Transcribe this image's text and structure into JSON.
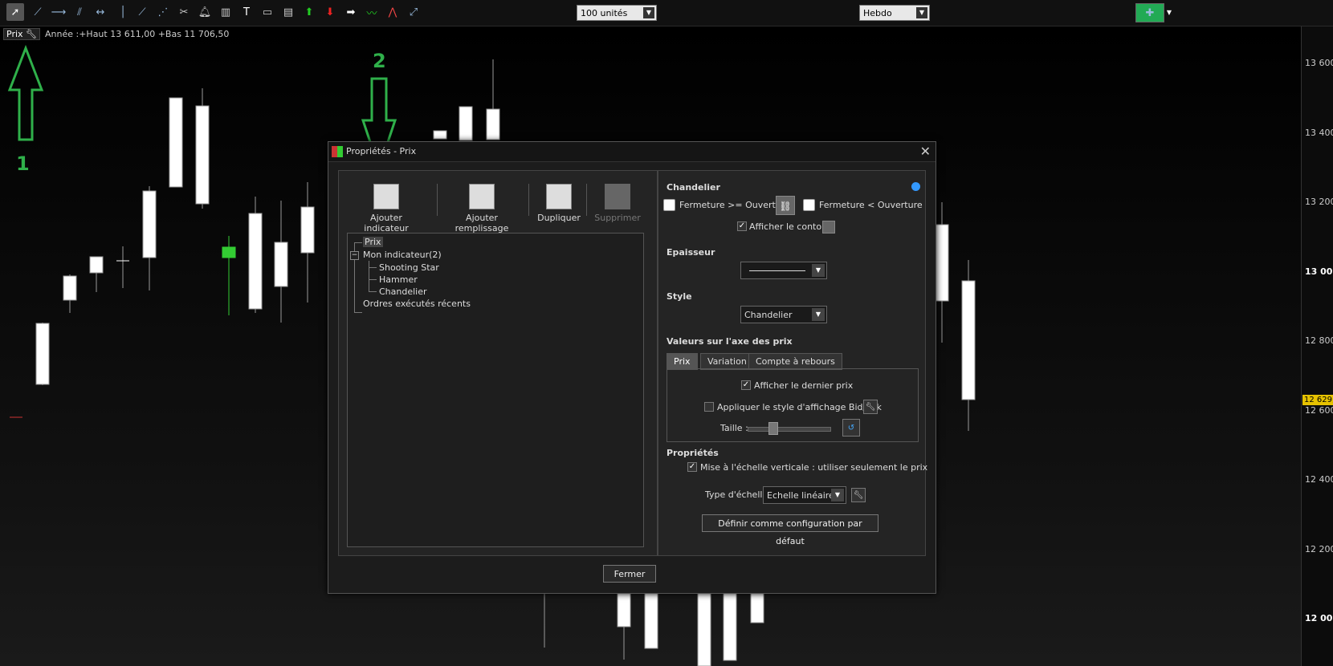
{
  "toolbar": {
    "units_value": "100 unités",
    "period_value": "Hebdo"
  },
  "legend": {
    "instrument": "Prix",
    "info": "Année :+Haut 13 611,00 +Bas 11 706,50"
  },
  "price_axis": {
    "ticks": [
      "13 600",
      "13 400",
      "13 200",
      "13 000",
      "12 800",
      "12 600",
      "12 400",
      "12 200",
      "12 000"
    ],
    "last_price": "12 629,"
  },
  "annotations": {
    "one": "1",
    "two": "2"
  },
  "dialog": {
    "title": "Propriétés - Prix",
    "close_symbol": "✕",
    "actions": {
      "add_indicator": "Ajouter indicateur",
      "add_fill": "Ajouter remplissage",
      "duplicate": "Dupliquer",
      "delete": "Supprimer"
    },
    "tree": {
      "prix": "Prix",
      "expander": "−",
      "mon_indicateur": "Mon indicateur(2)",
      "shooting_star": "Shooting Star",
      "hammer": "Hammer",
      "chandelier": "Chandelier",
      "ordres": "Ordres exécutés récents"
    },
    "chandelier": {
      "title": "Chandelier",
      "close_ge_open": "Fermeture >= Ouverture",
      "close_lt_open": "Fermeture  < Ouverture",
      "show_outline": "Afficher le contour"
    },
    "epaisseur": {
      "title": "Epaisseur"
    },
    "style": {
      "title": "Style",
      "value": "Chandelier"
    },
    "axis_values": {
      "title": "Valeurs sur l'axe des prix",
      "tabs": [
        "Prix",
        "Variation",
        "Compte à rebours"
      ],
      "show_last_price": "Afficher le dernier prix",
      "bid_ask": "Appliquer le style d'affichage Bid/Ask",
      "size_label": "Taille :"
    },
    "properties": {
      "title": "Propriétés",
      "vertical_scale": "Mise à l'échelle verticale : utiliser seulement le prix",
      "scale_type_label": "Type d'échelle",
      "scale_type_value": "Echelle linéaire",
      "default_button": "Définir comme configuration par défaut"
    },
    "close_button": "Fermer"
  }
}
